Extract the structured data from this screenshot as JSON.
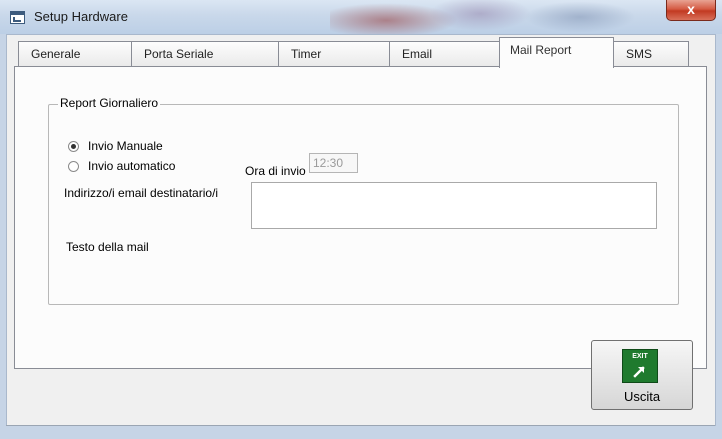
{
  "window": {
    "title": "Setup Hardware",
    "close_label": "x"
  },
  "tabs": [
    {
      "label": "Generale",
      "active": false
    },
    {
      "label": "Porta Seriale",
      "active": false
    },
    {
      "label": "Timer",
      "active": false
    },
    {
      "label": "Email",
      "active": false
    },
    {
      "label": "Mail Report",
      "active": true
    },
    {
      "label": "SMS",
      "active": false
    }
  ],
  "report": {
    "group_title": "Report Giornaliero",
    "radio_manual": {
      "label": "Invio Manuale",
      "checked": true
    },
    "radio_auto": {
      "label": "Invio automatico",
      "checked": false
    },
    "time_label": "Ora di invio",
    "time_value": "12:30",
    "email_label": "Indirizzo/i email destinatario/i",
    "email_value": "",
    "mail_text_label": "Testo della mail"
  },
  "exit_button": {
    "icon_text": "EXIT",
    "label": "Uscita"
  },
  "colors": {
    "exit_icon_bg": "#1f7a2e",
    "close_button_bg": "#c23a22"
  }
}
